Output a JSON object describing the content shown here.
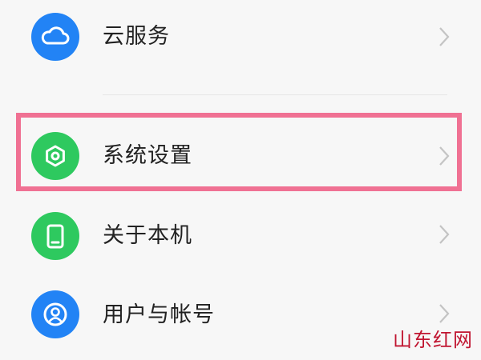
{
  "colors": {
    "blue": "#2283f5",
    "green": "#2ec95f",
    "highlight": "#f07193",
    "watermark": "#c01530"
  },
  "settings": {
    "items": [
      {
        "label": "云服务",
        "icon": "cloud-icon",
        "color": "#2283f5"
      },
      {
        "label": "系统设置",
        "icon": "settings-hex-icon",
        "color": "#2ec95f",
        "highlighted": true
      },
      {
        "label": "关于本机",
        "icon": "phone-icon",
        "color": "#2ec95f"
      },
      {
        "label": "用户与帐号",
        "icon": "user-account-icon",
        "color": "#2283f5"
      }
    ]
  },
  "watermark": {
    "text": "山东红网"
  }
}
